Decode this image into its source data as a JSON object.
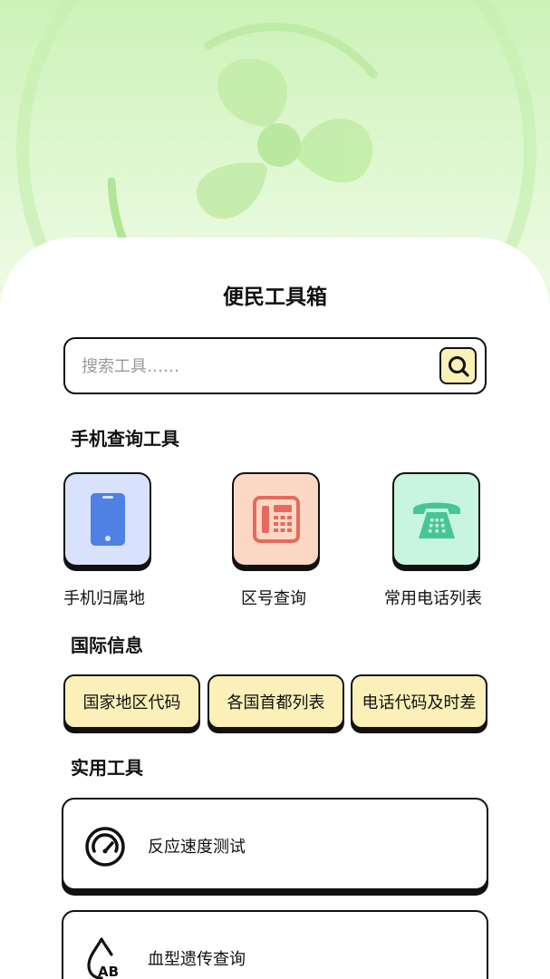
{
  "header": {
    "title": "便民工具箱"
  },
  "search": {
    "placeholder": "搜索工具……"
  },
  "sections": {
    "phone_tools": "手机查询工具",
    "international": "国际信息",
    "utilities": "实用工具"
  },
  "phone_tools": [
    {
      "label": "手机归属地",
      "icon": "smartphone-icon",
      "bg": "#d9e2fd",
      "accent": "#4f80e4"
    },
    {
      "label": "区号查询",
      "icon": "landline-phone-icon",
      "bg": "#fcd8c4",
      "accent": "#e56a5c"
    },
    {
      "label": "常用电话列表",
      "icon": "telephone-icon",
      "bg": "#c8f5df",
      "accent": "#46c598"
    }
  ],
  "international": [
    {
      "label": "国家地区代码"
    },
    {
      "label": "各国首都列表"
    },
    {
      "label": "电话代码及时差"
    }
  ],
  "utilities": [
    {
      "label": "反应速度测试",
      "icon": "speedometer-icon"
    },
    {
      "label": "血型遗传查询",
      "icon": "blood-type-ab-icon"
    }
  ],
  "colors": {
    "chip_bg": "#fbf0b8",
    "hero_bg": "#d6f5c5"
  }
}
